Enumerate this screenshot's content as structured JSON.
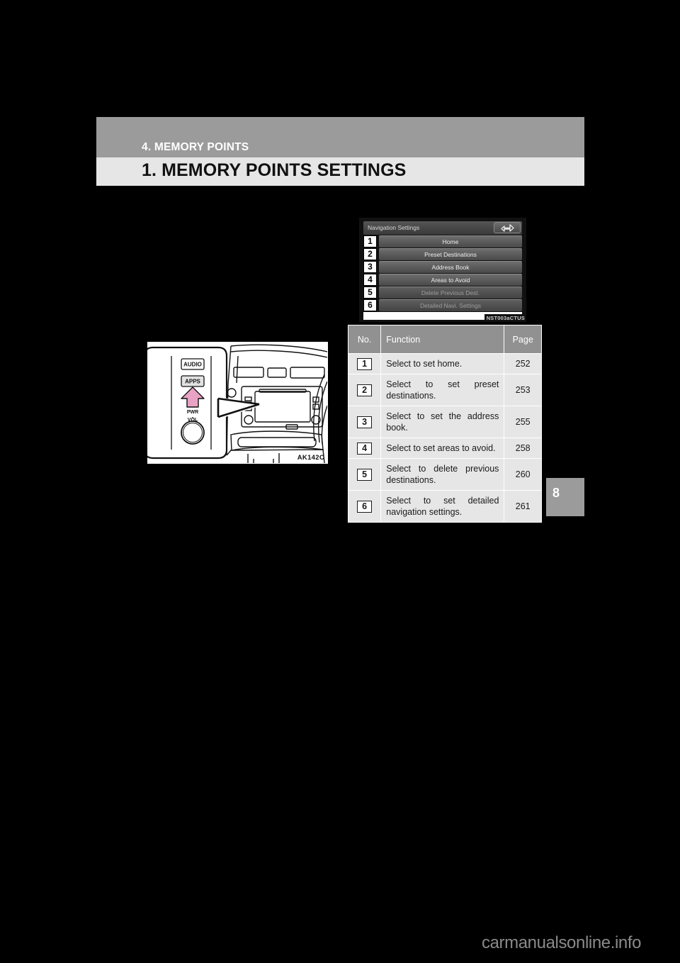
{
  "header": {
    "chapter": "4. MEMORY POINTS",
    "title": "1. MEMORY POINTS SETTINGS",
    "tab_number": "8"
  },
  "nav_screen": {
    "title": "Navigation Settings",
    "back_icon": "back-arrow-icon",
    "caption": "NST003aCTUS",
    "items": [
      {
        "number": "1",
        "label": "Home",
        "dim": false
      },
      {
        "number": "2",
        "label": "Preset Destinations",
        "dim": false
      },
      {
        "number": "3",
        "label": "Address Book",
        "dim": false
      },
      {
        "number": "4",
        "label": "Areas to Avoid",
        "dim": false
      },
      {
        "number": "5",
        "label": "Delete Previous Dest.",
        "dim": true
      },
      {
        "number": "6",
        "label": "Detailed Navi. Settings",
        "dim": true
      }
    ]
  },
  "function_table": {
    "headers": {
      "no": "No.",
      "function": "Function",
      "page": "Page"
    },
    "rows": [
      {
        "no": "1",
        "function": "Select to set home.",
        "page": "252"
      },
      {
        "no": "2",
        "function": "Select to set preset destinations.",
        "page": "253"
      },
      {
        "no": "3",
        "function": "Select to set the address book.",
        "page": "255"
      },
      {
        "no": "4",
        "function": "Select to set areas to avoid.",
        "page": "258"
      },
      {
        "no": "5",
        "function": "Select to delete previous destinations.",
        "page": "260"
      },
      {
        "no": "6",
        "function": "Select to set detailed navigation settings.",
        "page": "261"
      }
    ]
  },
  "dashboard": {
    "caption": "AK142C",
    "audio_button": "AUDIO",
    "apps_button": "APPS",
    "knob_label_top": "PWR",
    "knob_label_bottom": "VOL",
    "arrow_color": "#e8a2c4"
  },
  "watermark": "carmanualsonline.info"
}
